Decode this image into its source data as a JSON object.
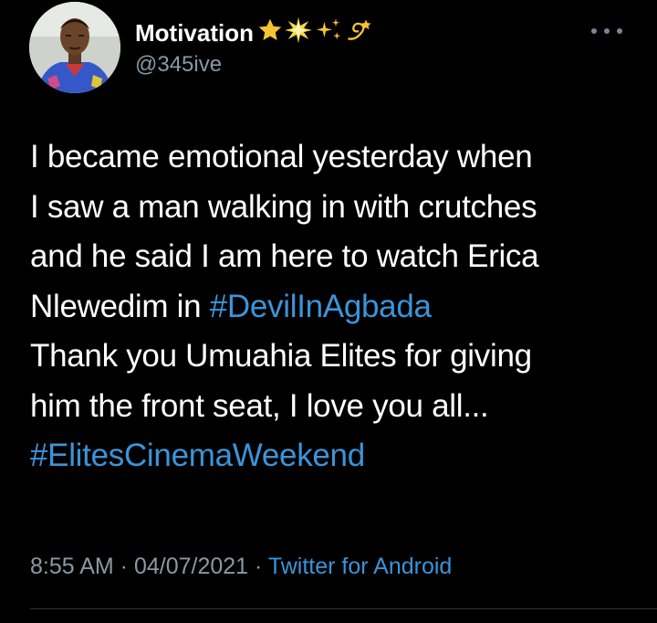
{
  "user": {
    "display_name": "Motivation",
    "emojis": [
      "star-emoji",
      "glowing-star-emoji",
      "sparkles-emoji",
      "dizzy-emoji"
    ],
    "handle": "@345ive"
  },
  "tweet": {
    "lines": [
      {
        "text": "I became emotional yesterday when"
      },
      {
        "text": "I saw a man walking in with crutches"
      },
      {
        "text": "and he said I am here to watch Erica"
      },
      {
        "text": "Nlewedim in ",
        "hashtag": "#DevilInAgbada"
      },
      {
        "text": "Thank you Umuahia Elites for giving"
      },
      {
        "text": "him the front seat, I love you all..."
      },
      {
        "text": "",
        "hashtag": "#ElitesCinemaWeekend"
      }
    ]
  },
  "meta": {
    "time": "8:55 AM",
    "separator1": " · ",
    "date": "04/07/2021",
    "separator2": " · ",
    "source": "Twitter for Android"
  },
  "colors": {
    "background": "#000000",
    "text": "#ffffff",
    "secondary": "#8b98a5",
    "link": "#3b94d9",
    "star": "#f4c430"
  },
  "icons": {
    "more": "more-options-icon",
    "avatar": "profile-avatar"
  }
}
